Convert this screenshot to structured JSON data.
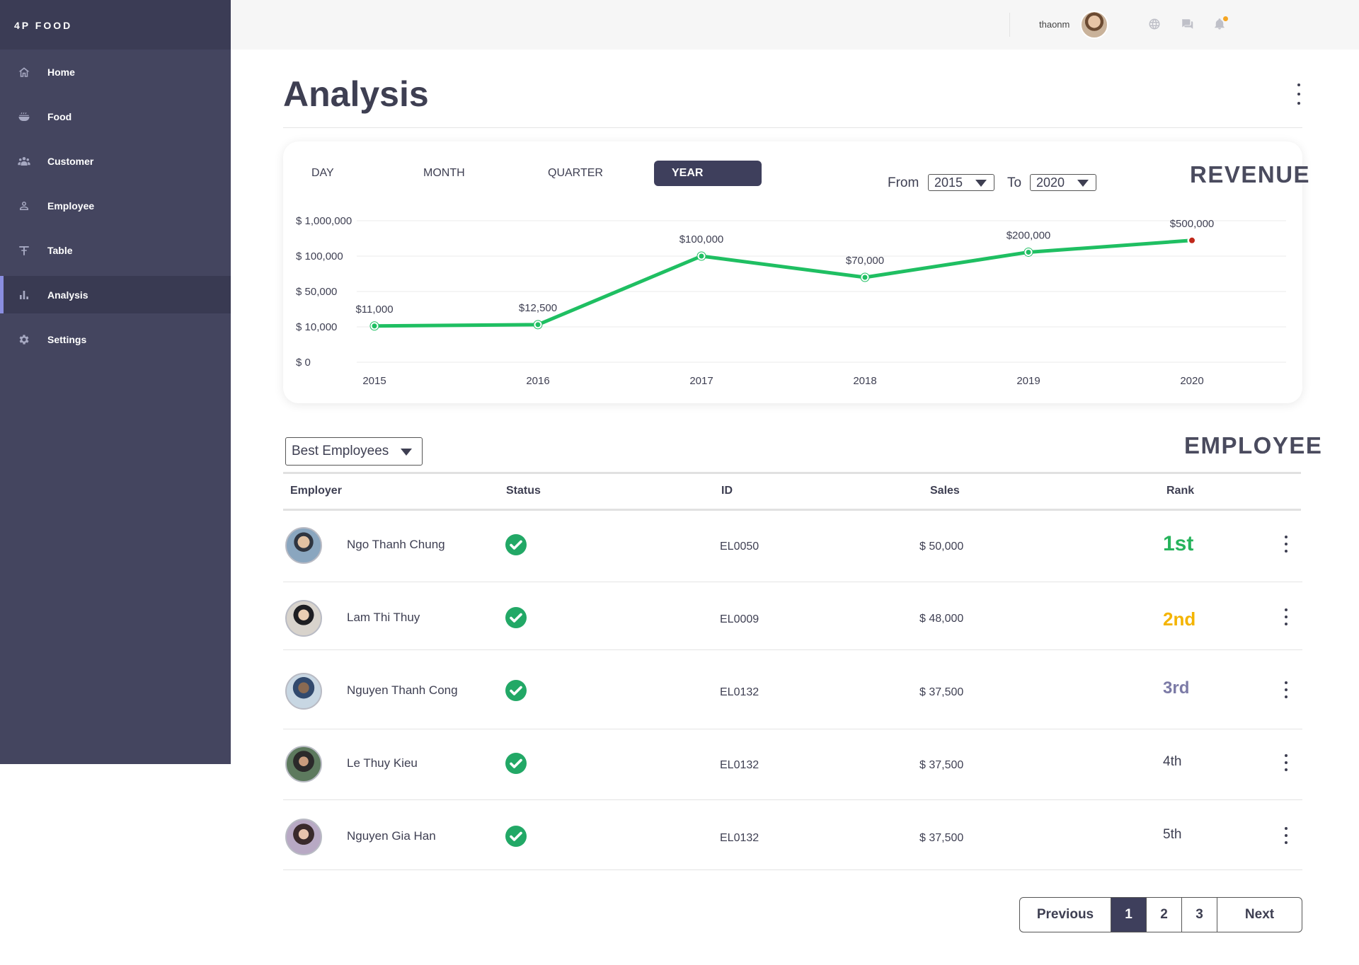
{
  "brand": "4P FOOD",
  "sidebar": {
    "items": [
      {
        "label": "Home",
        "icon": "home-icon"
      },
      {
        "label": "Food",
        "icon": "food-bowl-icon"
      },
      {
        "label": "Customer",
        "icon": "customers-icon"
      },
      {
        "label": "Employee",
        "icon": "employee-icon"
      },
      {
        "label": "Table",
        "icon": "table-icon"
      },
      {
        "label": "Analysis",
        "icon": "bar-chart-icon",
        "active": true
      },
      {
        "label": "Settings",
        "icon": "gear-icon"
      }
    ]
  },
  "topbar": {
    "icons": [
      "globe-icon",
      "chat-icon",
      "bell-icon"
    ],
    "username": "thaonm"
  },
  "page": {
    "title": "Analysis"
  },
  "revenue": {
    "title": "REVENUE",
    "tabs": [
      "DAY",
      "MONTH",
      "QUARTER",
      "YEAR"
    ],
    "active_tab": "YEAR",
    "from_label": "From",
    "from_value": "2015",
    "to_label": "To",
    "to_value": "2020"
  },
  "chart_data": {
    "type": "line",
    "x": [
      "2015",
      "2016",
      "2017",
      "2018",
      "2019",
      "2020"
    ],
    "values": [
      11000,
      12500,
      100000,
      70000,
      200000,
      500000
    ],
    "data_labels": [
      "$11,000",
      "$12,500",
      "$100,000",
      "$70,000",
      "$200,000",
      "$500,000"
    ],
    "y_ticks": [
      "$ 1,000,000",
      "$ 100,000",
      "$ 50,000",
      "$ 10,000",
      "$ 0"
    ],
    "grid": true,
    "line_color": "#1fbf62",
    "highlight_point_color": "#c0281a",
    "highlighted_point": "2020"
  },
  "employee": {
    "title": "EMPLOYEE",
    "filter": "Best Employees",
    "columns": [
      "Employer",
      "Status",
      "ID",
      "Sales",
      "Rank"
    ],
    "rows": [
      {
        "name": "Ngo Thanh Chung",
        "status": "active",
        "id": "EL0050",
        "sales": "$ 50,000",
        "rank": "1st",
        "rank_color": "#27b35c"
      },
      {
        "name": "Lam Thi Thuy",
        "status": "active",
        "id": "EL0009",
        "sales": "$ 48,000",
        "rank": "2nd",
        "rank_color": "#f4b400"
      },
      {
        "name": "Nguyen Thanh Cong",
        "status": "active",
        "id": "EL0132",
        "sales": "$ 37,500",
        "rank": "3rd",
        "rank_color": "#7b7aa6"
      },
      {
        "name": "Le Thuy Kieu",
        "status": "active",
        "id": "EL0132",
        "sales": "$ 37,500",
        "rank": "4th",
        "rank_color": "#3e3f52"
      },
      {
        "name": "Nguyen Gia Han",
        "status": "active",
        "id": "EL0132",
        "sales": "$ 37,500",
        "rank": "5th",
        "rank_color": "#3e3f52"
      }
    ]
  },
  "pagination": {
    "previous": "Previous",
    "pages": [
      "1",
      "2",
      "3"
    ],
    "current": "1",
    "next": "Next"
  },
  "colors": {
    "sidebar_bg": "#44455f",
    "accent": "#3e3f5c",
    "success": "#22a866"
  }
}
